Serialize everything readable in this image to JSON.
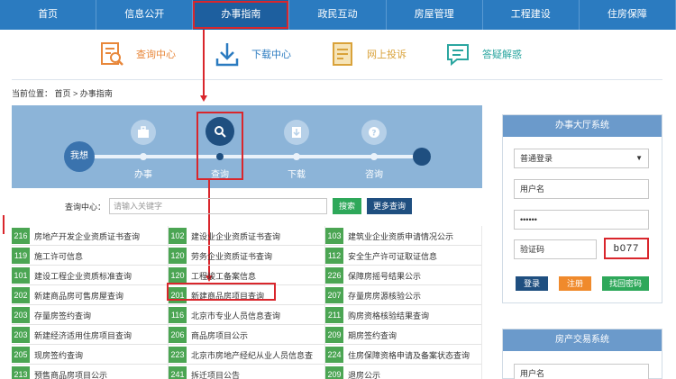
{
  "nav": {
    "items": [
      "首页",
      "信息公开",
      "办事指南",
      "政民互动",
      "房屋管理",
      "工程建设",
      "住房保障"
    ],
    "active_index": 2
  },
  "services": [
    {
      "label": "查询中心",
      "icon": "search-document-icon",
      "color": "#e8873a"
    },
    {
      "label": "下载中心",
      "icon": "download-icon",
      "color": "#2b7bc0"
    },
    {
      "label": "网上投诉",
      "icon": "complaint-document-icon",
      "color": "#d9a23a"
    },
    {
      "label": "答疑解惑",
      "icon": "chat-bubble-icon",
      "color": "#2ba6a0"
    }
  ],
  "breadcrumb": "当前位置： 首页 > 办事指南",
  "process": {
    "start_label": "我想",
    "steps": [
      {
        "label": "办事",
        "icon": "briefcase-icon"
      },
      {
        "label": "查询",
        "icon": "search-icon"
      },
      {
        "label": "下载",
        "icon": "download-file-icon"
      },
      {
        "label": "咨询",
        "icon": "question-icon"
      }
    ],
    "active_index": 1
  },
  "search": {
    "label": "查询中心：",
    "placeholder": "请输入关键字",
    "search_button": "搜索",
    "more_button": "更多查询"
  },
  "list": [
    [
      {
        "num": "216",
        "text": "房地产开发企业资质证书查询"
      },
      {
        "num": "102",
        "text": "建设业企业资质证书查询"
      },
      {
        "num": "103",
        "text": "建筑业企业资质申请情况公示"
      }
    ],
    [
      {
        "num": "119",
        "text": "施工许可信息"
      },
      {
        "num": "120",
        "text": "劳务企业资质证书查询"
      },
      {
        "num": "112",
        "text": "安全生产许可证取证信息"
      }
    ],
    [
      {
        "num": "101",
        "text": "建设工程企业资质标准查询"
      },
      {
        "num": "120",
        "text": "工程竣工备案信息"
      },
      {
        "num": "226",
        "text": "保障房摇号结果公示"
      }
    ],
    [
      {
        "num": "202",
        "text": "新建商品房可售房屋查询"
      },
      {
        "num": "201",
        "text": "新建商品房项目查询"
      },
      {
        "num": "207",
        "text": "存量房房源核验公示"
      }
    ],
    [
      {
        "num": "203",
        "text": "存量房签约查询"
      },
      {
        "num": "116",
        "text": "北京市专业人员信息查询"
      },
      {
        "num": "211",
        "text": "购房资格核验结果查询"
      }
    ],
    [
      {
        "num": "203",
        "text": "新建经济适用住房项目查询"
      },
      {
        "num": "206",
        "text": "商品房项目公示"
      },
      {
        "num": "209",
        "text": "期房签约查询"
      }
    ],
    [
      {
        "num": "205",
        "text": "现房签约查询"
      },
      {
        "num": "223",
        "text": "北京市房地产经纪从业人员信息查"
      },
      {
        "num": "224",
        "text": "住房保障资格申请及备案状态查询"
      }
    ],
    [
      {
        "num": "213",
        "text": "预售商品房项目公示"
      },
      {
        "num": "241",
        "text": "拆迁项目公告"
      },
      {
        "num": "209",
        "text": "退房公示"
      }
    ]
  ],
  "panel1": {
    "title": "办事大厅系统",
    "login_type": "普通登录",
    "username_placeholder": "用户名",
    "password_value": "••••••",
    "captcha_placeholder": "验证码",
    "captcha_code": "b077",
    "login_button": "登录",
    "register_button": "注册",
    "recover_button": "找回密码"
  },
  "panel2": {
    "title": "房产交易系统",
    "username_placeholder": "用户名"
  }
}
